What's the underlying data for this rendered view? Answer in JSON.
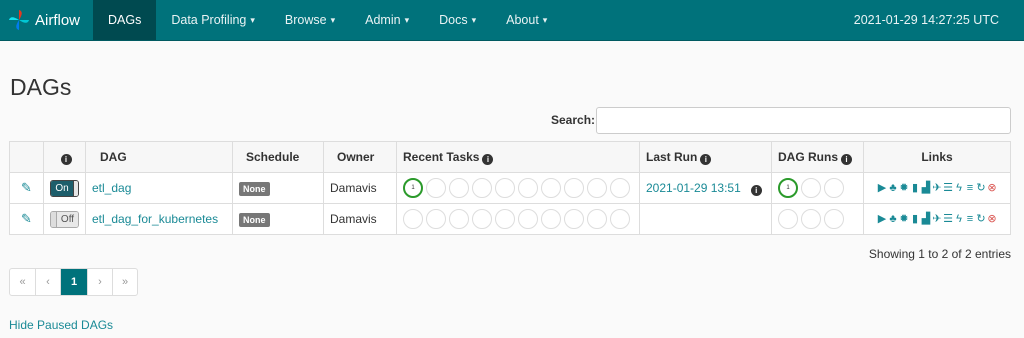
{
  "navbar": {
    "brand": "Airflow",
    "items": [
      {
        "label": "DAGs",
        "caret": ""
      },
      {
        "label": "Data Profiling",
        "caret": "▾"
      },
      {
        "label": "Browse",
        "caret": "▾"
      },
      {
        "label": "Admin",
        "caret": "▾"
      },
      {
        "label": "Docs",
        "caret": "▾"
      },
      {
        "label": "About",
        "caret": "▾"
      }
    ],
    "clock": "2021-01-29 14:27:25 UTC"
  },
  "page": {
    "title": "DAGs",
    "search_label": "Search:",
    "search_value": "",
    "showing": "Showing 1 to 2 of 2 entries",
    "hide_paused": "Hide Paused DAGs"
  },
  "table": {
    "headers": {
      "info": "i",
      "dag": "DAG",
      "schedule": "Schedule",
      "owner": "Owner",
      "recent_tasks": "Recent Tasks",
      "last_run": "Last Run",
      "dag_runs": "DAG Runs",
      "links": "Links"
    },
    "rows": [
      {
        "toggle": "On",
        "dag": "etl_dag",
        "schedule": "None",
        "owner": "Damavis",
        "recent_task_count": "1",
        "last_run": "2021-01-29 13:51",
        "dag_run_count": "1"
      },
      {
        "toggle": "Off",
        "dag": "etl_dag_for_kubernetes",
        "schedule": "None",
        "owner": "Damavis",
        "recent_task_count": "",
        "last_run": "",
        "dag_run_count": ""
      }
    ]
  },
  "pagination": {
    "first": "«",
    "prev": "‹",
    "current": "1",
    "next": "›",
    "last": "»"
  },
  "icons": {
    "edit": "edit-icon",
    "info": "info-icon",
    "links": [
      "trigger-dag-icon",
      "tree-view-icon",
      "graph-view-icon",
      "task-duration-icon",
      "task-tries-icon",
      "landing-times-icon",
      "gantt-icon",
      "code-icon",
      "logs-icon",
      "refresh-icon",
      "delete-icon"
    ]
  },
  "colors": {
    "navbar": "#00727b",
    "accent": "#1a8a96",
    "success": "#2b9a2b",
    "danger": "#d9534f"
  }
}
